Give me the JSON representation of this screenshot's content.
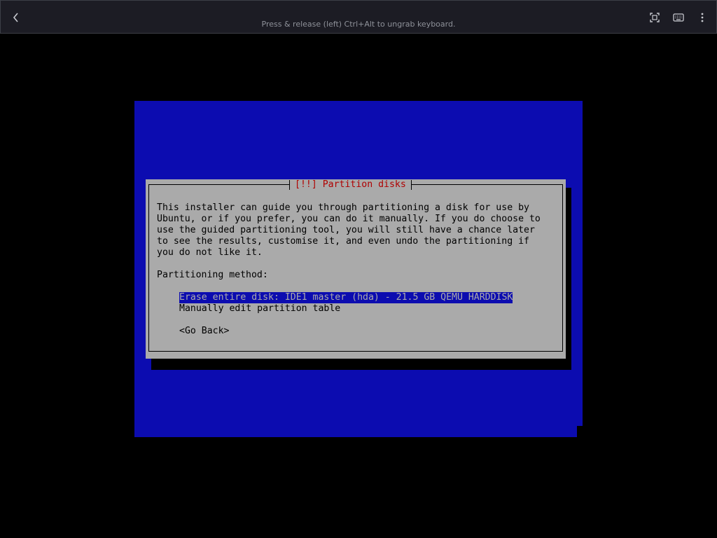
{
  "header": {
    "hint": "Press & release (left) Ctrl+Alt to ungrab keyboard.",
    "icons": {
      "back": "chevron-left-icon",
      "fullscreen": "fullscreen-icon",
      "keyboard": "keyboard-icon",
      "more": "more-vertical-icon"
    }
  },
  "colors": {
    "header_bg": "#1c1c24",
    "installer_blue": "#0c0cb0",
    "dialog_gray": "#aaaaaa",
    "title_red": "#b00000"
  },
  "dialog": {
    "title": "[!!] Partition disks",
    "body_lines": [
      "This installer can guide you through partitioning a disk for use by",
      "Ubuntu, or if you prefer, you can do it manually. If you do choose to",
      "use the guided partitioning tool, you will still have a chance later",
      "to see the results, customise it, and even undo the partitioning if",
      "you do not like it."
    ],
    "prompt": "Partitioning method:",
    "options": [
      "Erase entire disk: IDE1 master (hda) - 21.5 GB QEMU HARDDISK",
      "Manually edit partition table"
    ],
    "selected_option": 0,
    "go_back": "<Go Back>"
  }
}
